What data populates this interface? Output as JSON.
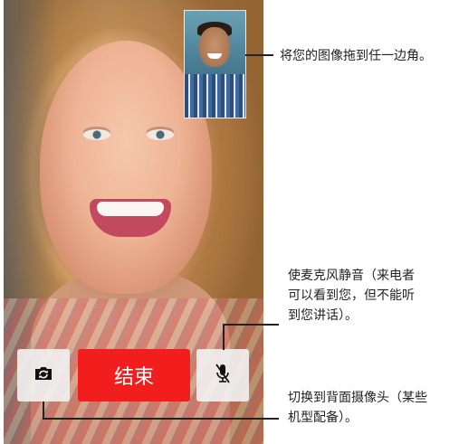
{
  "call": {
    "end_button_label": "结束"
  },
  "icons": {
    "camera_switch": "camera-rotate-icon",
    "mute": "microphone-mute-icon"
  },
  "callouts": {
    "preview": "将您的图像拖到任一边角。",
    "mute": "使麦克风静音（来电者\n可以看到您，但不能听\n到您讲话）。",
    "camera": "切换到背面摄像头（某些\n机型配备）。"
  },
  "colors": {
    "end_button": "#f21e1e",
    "control_button": "#f0f0f0",
    "callout_text": "#222222"
  }
}
